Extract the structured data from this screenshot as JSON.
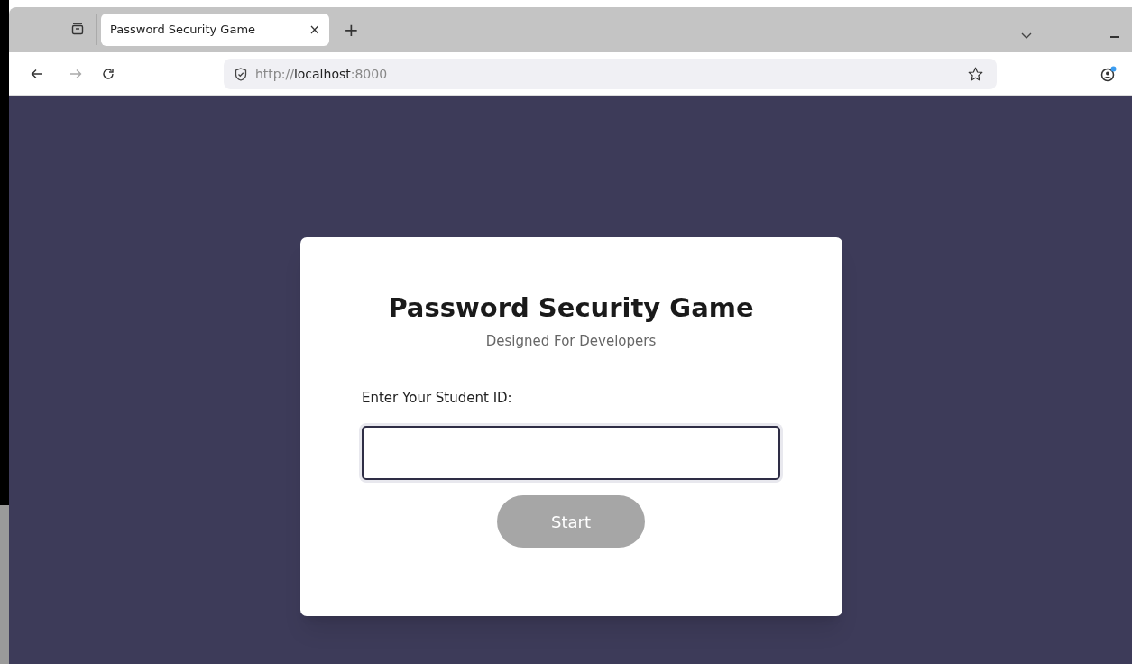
{
  "browser": {
    "tabs": [
      {
        "title": "Password Security Game",
        "close": "×",
        "selected": true
      }
    ],
    "new_tab": "+",
    "address": {
      "scheme": "http://",
      "host": "localhost",
      "port": ":8000"
    }
  },
  "card": {
    "title": "Password Security Game",
    "subtitle": "Designed For Developers",
    "label": "Enter Your Student ID:",
    "button": {
      "label": "Start",
      "disabled": true
    }
  }
}
